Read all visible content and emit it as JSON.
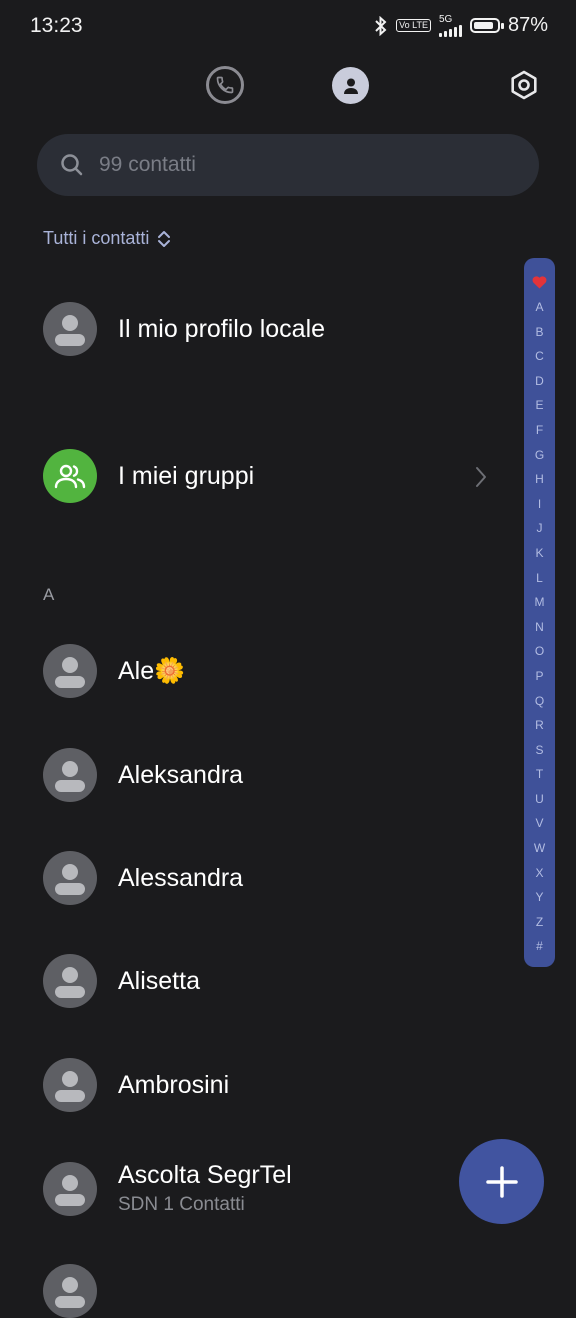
{
  "status_bar": {
    "time": "13:23",
    "lte_label": "Vo LTE",
    "network": "5G",
    "battery": "87%",
    "battery_level": 0.87
  },
  "search": {
    "placeholder": "99 contatti"
  },
  "filter": {
    "label": "Tutti i contatti"
  },
  "special_rows": {
    "profile": "Il mio profilo locale",
    "groups": "I miei gruppi"
  },
  "section": {
    "letter": "A"
  },
  "contacts": [
    {
      "name": "Ale🌼"
    },
    {
      "name": "Aleksandra"
    },
    {
      "name": "Alessandra"
    },
    {
      "name": "Alisetta"
    },
    {
      "name": "Ambrosini"
    },
    {
      "name": "Ascolta SegrTel",
      "subtitle": "SDN 1 Contatti"
    }
  ],
  "alpha_index": [
    "A",
    "B",
    "C",
    "D",
    "E",
    "F",
    "G",
    "H",
    "I",
    "J",
    "K",
    "L",
    "M",
    "N",
    "O",
    "P",
    "Q",
    "R",
    "S",
    "T",
    "U",
    "V",
    "W",
    "X",
    "Y",
    "Z",
    "#"
  ],
  "icons": {
    "phone_tab": "phone-icon",
    "contacts_tab": "contact-person-icon",
    "settings": "gear-icon",
    "search": "search-icon",
    "filter": "sort-updown-icon",
    "favorites": "heart-icon",
    "add": "plus-icon"
  },
  "colors": {
    "background": "#1b1b1d",
    "accent": "#4154a0",
    "group_green": "#52b43f",
    "favorite_red": "#e3343a"
  }
}
